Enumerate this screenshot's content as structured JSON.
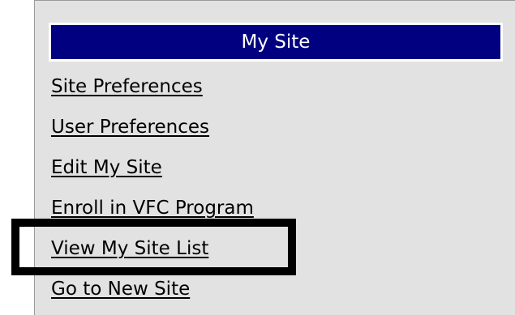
{
  "panel": {
    "title": "My Site"
  },
  "menu": {
    "items": [
      {
        "label": "Site Preferences"
      },
      {
        "label": "User Preferences"
      },
      {
        "label": "Edit My Site"
      },
      {
        "label": "Enroll in VFC Program"
      },
      {
        "label": "View My Site List"
      },
      {
        "label": "Go to New Site"
      }
    ]
  },
  "colors": {
    "header_bg": "#000080",
    "panel_bg": "#e2e2e2",
    "highlight": "#000000"
  }
}
